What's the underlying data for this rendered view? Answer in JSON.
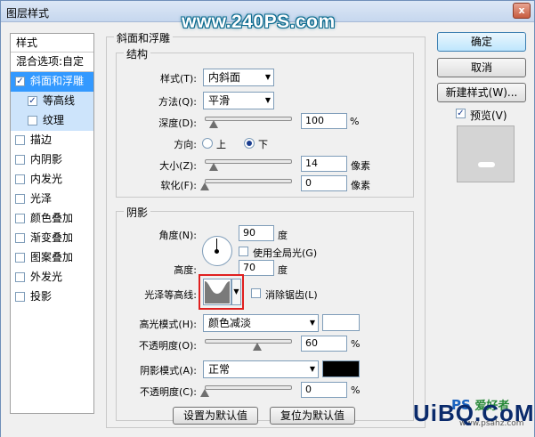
{
  "window": {
    "title": "图层样式",
    "close_label": "x"
  },
  "styles_list": {
    "header": "样式",
    "blend_options": "混合选项:自定",
    "items": [
      {
        "label": "斜面和浮雕",
        "checked": true,
        "state": "selected"
      },
      {
        "label": "等高线",
        "checked": true,
        "state": "sub"
      },
      {
        "label": "纹理",
        "checked": false,
        "state": "sub"
      },
      {
        "label": "描边",
        "checked": false
      },
      {
        "label": "内阴影",
        "checked": false
      },
      {
        "label": "内发光",
        "checked": false
      },
      {
        "label": "光泽",
        "checked": false
      },
      {
        "label": "颜色叠加",
        "checked": false
      },
      {
        "label": "渐变叠加",
        "checked": false
      },
      {
        "label": "图案叠加",
        "checked": false
      },
      {
        "label": "外发光",
        "checked": false
      },
      {
        "label": "投影",
        "checked": false
      }
    ]
  },
  "bevel": {
    "section_title": "斜面和浮雕",
    "structure": {
      "title": "结构",
      "style_label": "样式(T):",
      "style_value": "内斜面",
      "technique_label": "方法(Q):",
      "technique_value": "平滑",
      "depth_label": "深度(D):",
      "depth_value": "100",
      "depth_unit": "%",
      "depth_fraction": 0.1,
      "direction_label": "方向:",
      "direction_up": "上",
      "direction_down": "下",
      "direction_selected": "down",
      "size_label": "大小(Z):",
      "size_value": "14",
      "size_unit": "像素",
      "size_fraction": 0.1,
      "soften_label": "软化(F):",
      "soften_value": "0",
      "soften_unit": "像素",
      "soften_fraction": 0.0
    },
    "shading": {
      "title": "阴影",
      "angle_label": "角度(N):",
      "angle_value": "90",
      "angle_unit": "度",
      "global_light_label": "使用全局光(G)",
      "global_light_checked": false,
      "altitude_label": "高度:",
      "altitude_value": "70",
      "altitude_unit": "度",
      "gloss_contour_label": "光泽等高线:",
      "anti_aliased_label": "消除锯齿(L)",
      "anti_aliased_checked": false,
      "highlight_mode_label": "高光模式(H):",
      "highlight_mode_value": "颜色减淡",
      "highlight_color": "#ffffff",
      "highlight_opacity_label": "不透明度(O):",
      "highlight_opacity_value": "60",
      "highlight_opacity_unit": "%",
      "highlight_opacity_fraction": 0.6,
      "shadow_mode_label": "阴影模式(A):",
      "shadow_mode_value": "正常",
      "shadow_color": "#000000",
      "shadow_opacity_label": "不透明度(C):",
      "shadow_opacity_value": "0",
      "shadow_opacity_unit": "%",
      "shadow_opacity_fraction": 0.0
    },
    "make_default": "设置为默认值",
    "reset_default": "复位为默认值"
  },
  "actions": {
    "ok": "确定",
    "cancel": "取消",
    "new_style": "新建样式(W)...",
    "preview_label": "预览(V)",
    "preview_checked": true
  },
  "watermarks": {
    "top": "www.240PS.com",
    "bottom_brand": "UiBQ.CoM",
    "bottom_ps": "PS",
    "bottom_cn": "爱好者",
    "bottom_url": "www.psahz.com"
  }
}
